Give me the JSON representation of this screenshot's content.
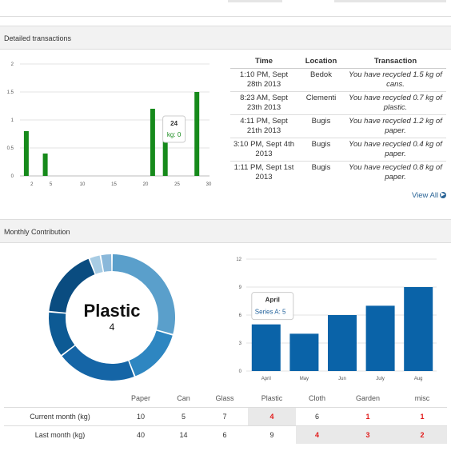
{
  "sections": {
    "transactions_title": "Detailed transactions",
    "monthly_title": "Monthly Contribution"
  },
  "transactions": {
    "headers": [
      "Time",
      "Location",
      "Transaction"
    ],
    "rows": [
      {
        "time": "1:10 PM, Sept 28th 2013",
        "location": "Bedok",
        "transaction": "You have recycled 1.5 kg of cans."
      },
      {
        "time": "8:23 AM, Sept 23th 2013",
        "location": "Clementi",
        "transaction": "You have recycled 0.7 kg of plastic."
      },
      {
        "time": "4:11 PM, Sept 21th 2013",
        "location": "Bugis",
        "transaction": "You have recycled 1.2 kg of paper."
      },
      {
        "time": "3:10 PM, Sept 4th 2013",
        "location": "Bugis",
        "transaction": "You have recycled 0.4 kg of paper."
      },
      {
        "time": "1:11 PM, Sept 1st 2013",
        "location": "Bugis",
        "transaction": "You have recycled 0.8 kg of paper."
      }
    ],
    "view_all": "View All"
  },
  "chart_data": [
    {
      "type": "bar",
      "x": [
        1,
        4,
        21,
        23,
        28
      ],
      "values": [
        0.8,
        0.4,
        1.2,
        0.7,
        1.5
      ],
      "xticks": [
        "2",
        "5",
        "10",
        "15",
        "20",
        "25",
        "30"
      ],
      "yticks": [
        "0",
        "0.5",
        "1",
        "1.5",
        "2"
      ],
      "xlim": [
        0,
        30
      ],
      "ylim": [
        0,
        2
      ],
      "grid": true,
      "color": "#168a1b",
      "tooltip": {
        "title": "24",
        "text": "kg: 0"
      }
    },
    {
      "type": "pie",
      "categories": [
        "Paper",
        "Can",
        "Glass",
        "Plastic",
        "Cloth",
        "Garden",
        "misc"
      ],
      "values": [
        10,
        5,
        7,
        4,
        6,
        1,
        1
      ],
      "colors": [
        "#5a9fcb",
        "#2e86c1",
        "#1565a6",
        "#0d5a94",
        "#0a4c80",
        "#a8cce4",
        "#8ab8da"
      ],
      "center_label": "Plastic",
      "center_value": "4"
    },
    {
      "type": "bar",
      "categories": [
        "April",
        "May",
        "Jun",
        "July",
        "Aug"
      ],
      "values": [
        5,
        4,
        6,
        7,
        9
      ],
      "yticks": [
        "0",
        "3",
        "6",
        "9",
        "12"
      ],
      "ylim": [
        0,
        12
      ],
      "grid": true,
      "color": "#0a63a8",
      "tooltip": {
        "title": "April",
        "text": "Series A: 5"
      }
    }
  ],
  "contribution": {
    "headers": [
      "",
      "Paper",
      "Can",
      "Glass",
      "Plastic",
      "Cloth",
      "Garden",
      "misc"
    ],
    "rows": [
      {
        "label": "Current month (kg)",
        "values": [
          "10",
          "5",
          "7",
          "4",
          "6",
          "1",
          "1"
        ]
      },
      {
        "label": "Last month (kg)",
        "values": [
          "40",
          "14",
          "6",
          "9",
          "4",
          "3",
          "2"
        ]
      }
    ]
  },
  "colors": {
    "green": "#168a1b",
    "blue": "#0a63a8",
    "red": "#e21c1c",
    "link": "#2a6496"
  }
}
